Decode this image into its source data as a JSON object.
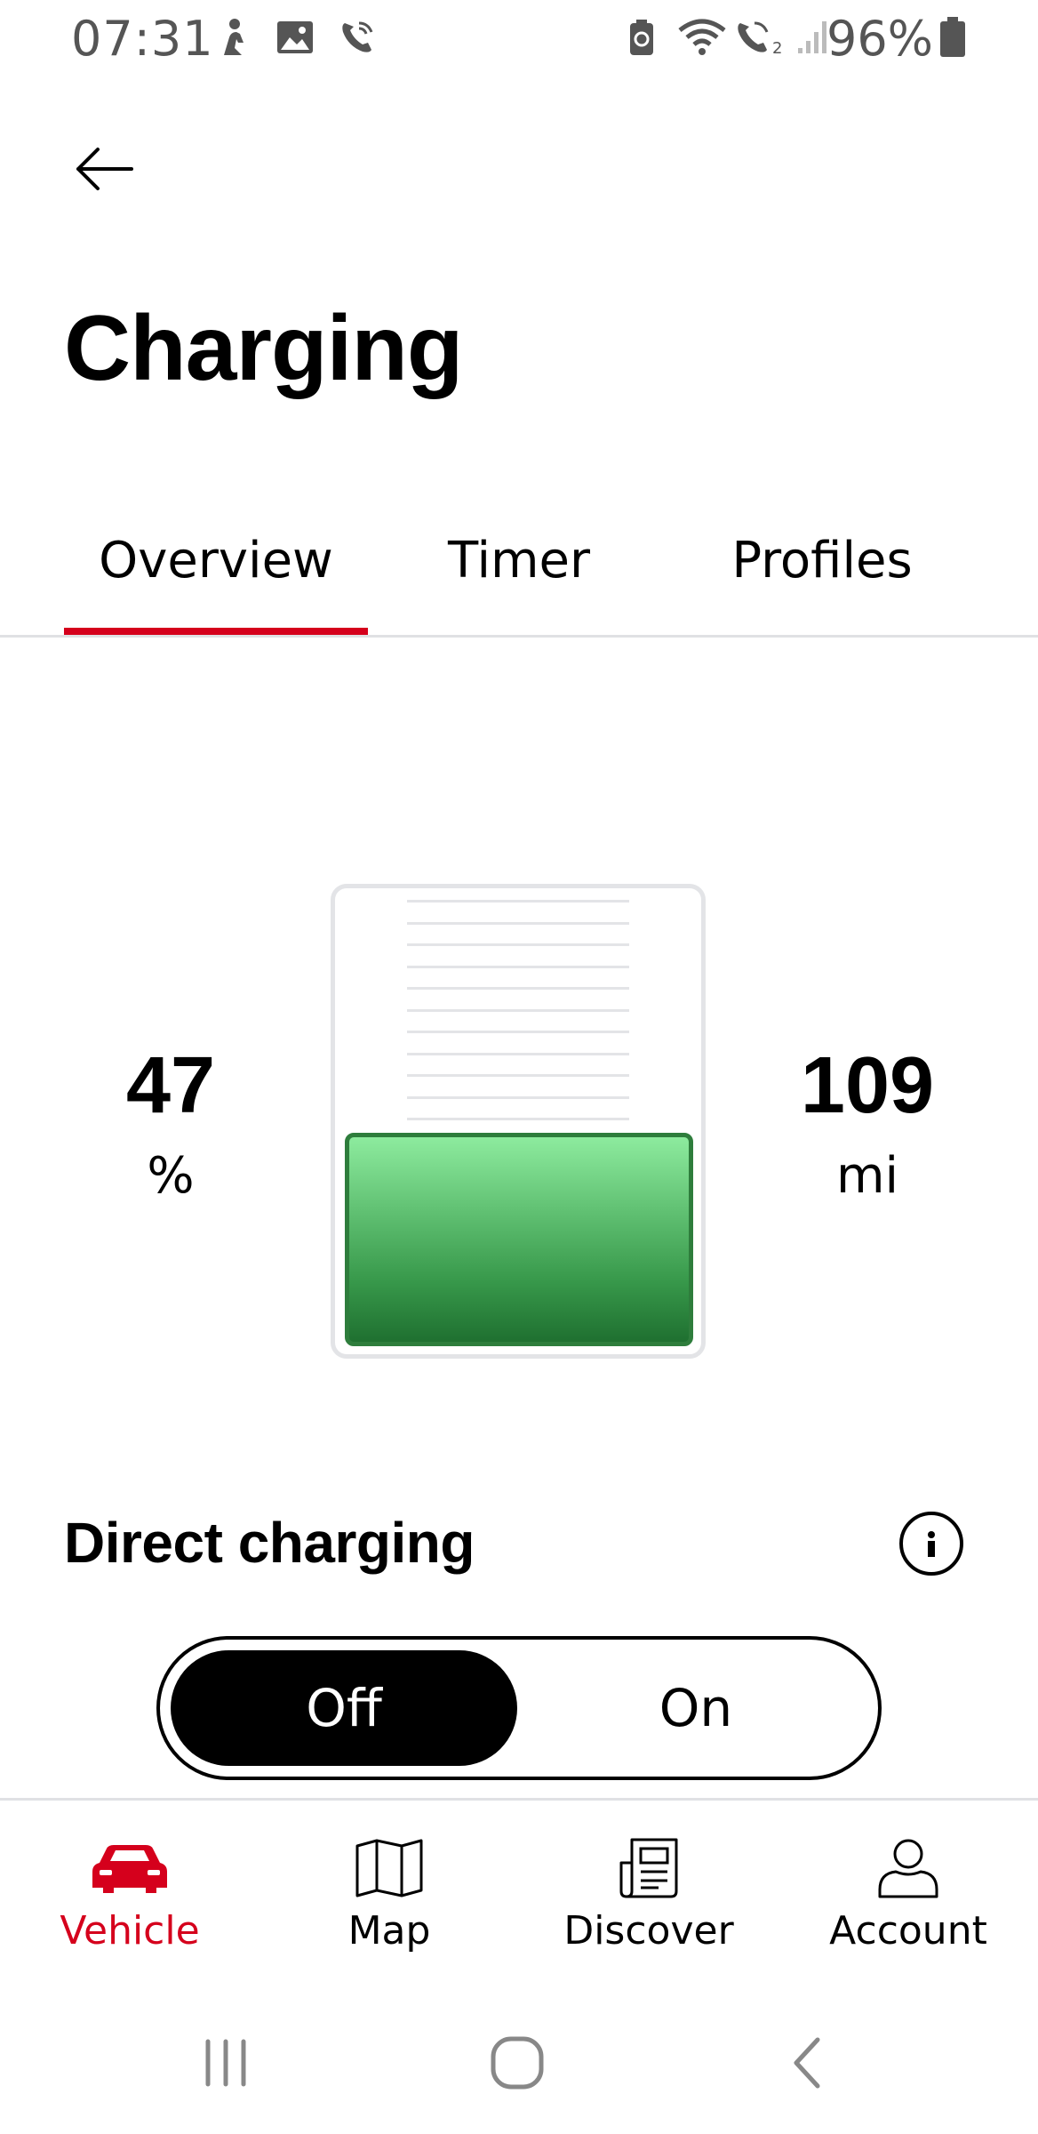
{
  "status_bar": {
    "time": "07:31",
    "battery_percent": "96%",
    "icons": [
      "person-walking-icon",
      "image-icon",
      "wifi-call-icon",
      "battery-saver-icon",
      "wifi-icon",
      "wifi-call-2-icon",
      "signal-icon",
      "battery-icon"
    ]
  },
  "header": {
    "back_icon": "arrow-left-icon",
    "title": "Charging"
  },
  "tabs": [
    {
      "label": "Overview",
      "active": true
    },
    {
      "label": "Timer",
      "active": false
    },
    {
      "label": "Profiles",
      "active": false
    }
  ],
  "battery": {
    "percent_value": "47",
    "percent_unit": "%",
    "range_value": "109",
    "range_unit": "mi",
    "level_fraction": 0.47
  },
  "direct_charging": {
    "title": "Direct charging",
    "info_icon": "info-icon",
    "options": [
      "Off",
      "On"
    ],
    "selected": "Off"
  },
  "bottom_nav": {
    "items": [
      {
        "label": "Vehicle",
        "icon": "car-icon",
        "active": true
      },
      {
        "label": "Map",
        "icon": "map-icon",
        "active": false
      },
      {
        "label": "Discover",
        "icon": "newspaper-icon",
        "active": false
      },
      {
        "label": "Account",
        "icon": "person-icon",
        "active": false
      }
    ]
  },
  "colors": {
    "accent": "#d5001c",
    "battery_green": "#38994b",
    "divider": "#e0e1e4"
  }
}
